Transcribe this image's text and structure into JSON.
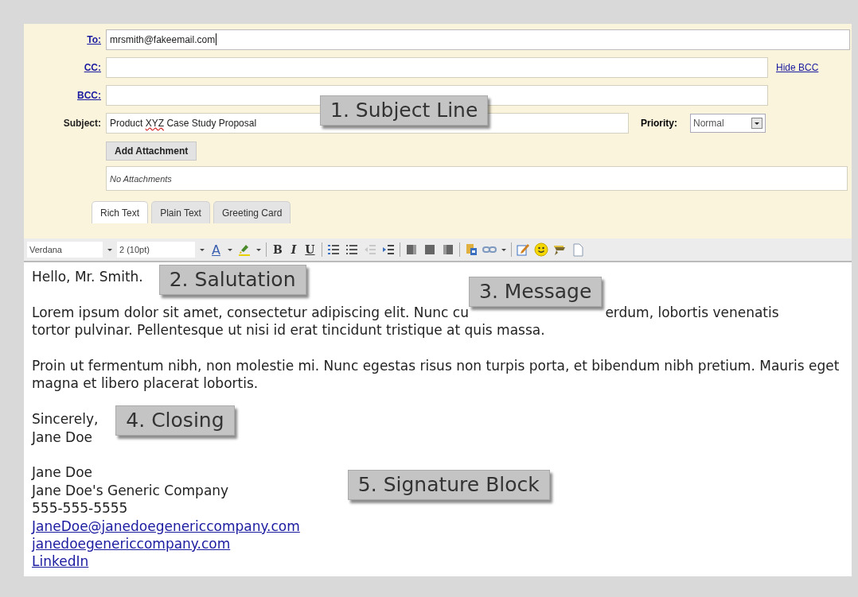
{
  "header": {
    "fields": [
      {
        "label": "To:",
        "value": "mrsmith@fakeemail.com",
        "focused": true
      },
      {
        "label": "CC:",
        "focused": false
      },
      {
        "label": "BCC:",
        "focused": false
      }
    ],
    "hide_bcc_link": "Hide BCC",
    "subject": {
      "label": "Subject:",
      "segments": [
        {
          "text": "Product ",
          "misspelled": false
        },
        {
          "text": "XYZ",
          "misspelled": true
        },
        {
          "text": " Case Study Proposal",
          "misspelled": false
        }
      ]
    },
    "priority": {
      "label": "Priority:",
      "value": "Normal"
    },
    "add_attachment_button": "Add Attachment",
    "attachments_placeholder": "No Attachments"
  },
  "tabs": [
    {
      "label": "Rich Text",
      "selected": true
    },
    {
      "label": "Plain Text",
      "selected": false
    },
    {
      "label": "Greeting Card",
      "selected": false
    }
  ],
  "toolbar": {
    "font": "Verdana",
    "size": "2 (10pt)",
    "text_color_glyph": "A",
    "format_buttons": [
      "B",
      "I",
      "U"
    ]
  },
  "body": {
    "greeting": "Hello, Mr. Smith.",
    "paragraph_1": {
      "line_start": "Lorem ipsum dolor sit amet, consectetur adipiscing elit. Nunc cu",
      "line_end": "erdum, lobortis venenatis",
      "rest": "tortor pulvinar. Pellentesque ut nisi id erat tincidunt tristique at quis massa."
    },
    "paragraph_2": "Proin ut fermentum nibh, non molestie mi. Nunc egestas risus non turpis porta, et bibendum nibh pretium. Mauris eget magna et libero placerat lobortis.",
    "closing": [
      "Sincerely,",
      "Jane Doe"
    ],
    "signature": [
      "Jane Doe",
      "Jane Doe's Generic Company",
      "555-555-5555"
    ],
    "signature_links": [
      "JaneDoe@janedoegenericcompany.com",
      "janedoegenericcompany.com",
      "LinkedIn"
    ]
  },
  "callouts": [
    "1. Subject Line",
    "2. Salutation",
    "3. Message",
    "4. Closing",
    "5. Signature Block"
  ]
}
